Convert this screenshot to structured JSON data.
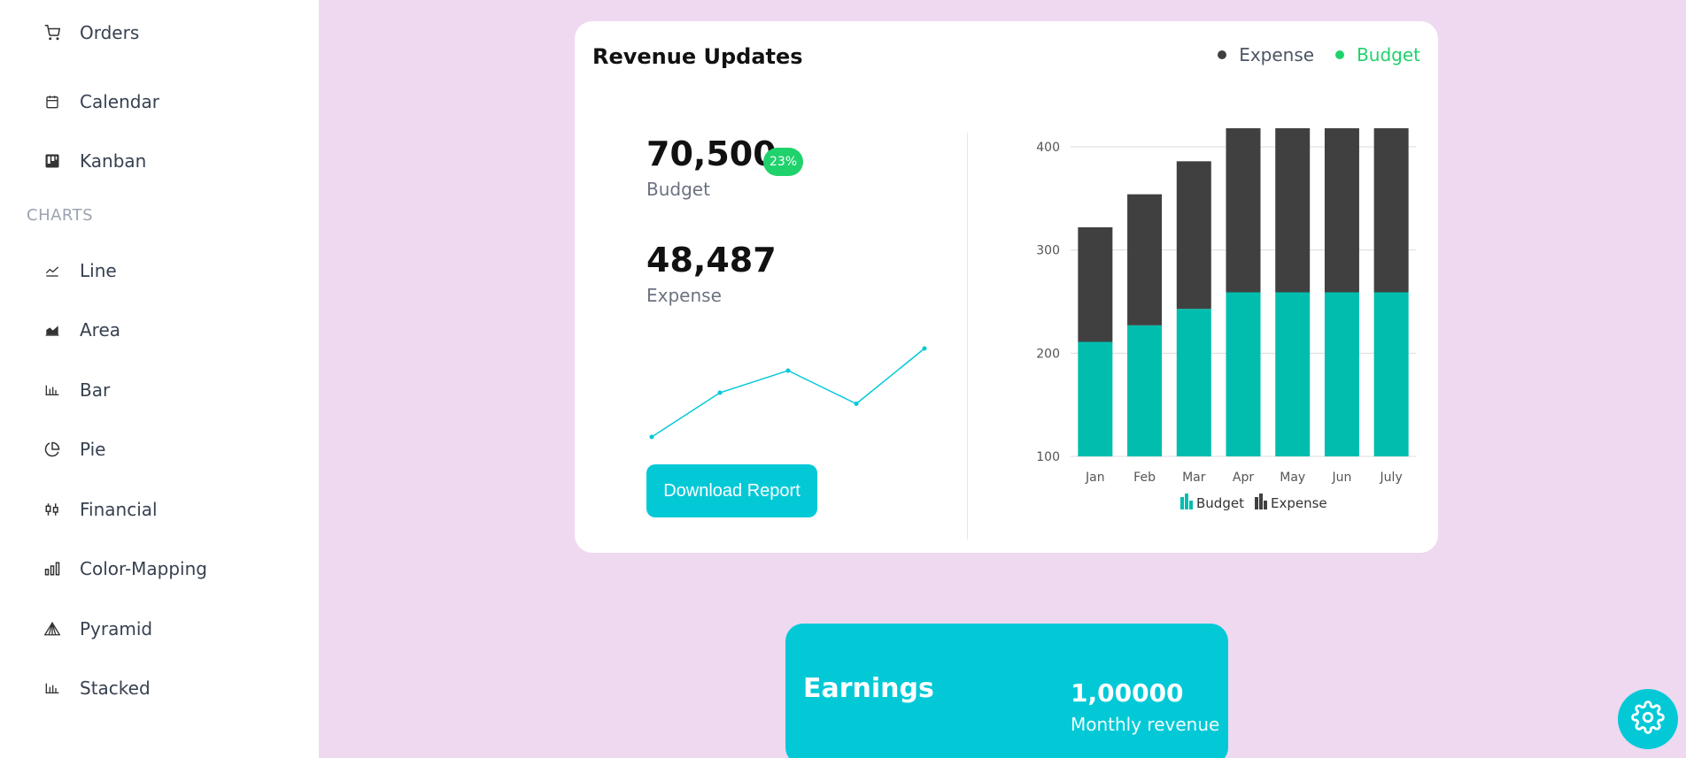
{
  "sidebar": {
    "items_top": [
      {
        "label": "Orders",
        "icon": "cart-icon"
      },
      {
        "label": "Calendar",
        "icon": "calendar-icon"
      },
      {
        "label": "Kanban",
        "icon": "kanban-icon"
      }
    ],
    "section_title": "CHARTS",
    "chart_items": [
      {
        "label": "Line",
        "icon": "line-chart-icon"
      },
      {
        "label": "Area",
        "icon": "area-chart-icon"
      },
      {
        "label": "Bar",
        "icon": "bar-chart-icon"
      },
      {
        "label": "Pie",
        "icon": "pie-chart-icon"
      },
      {
        "label": "Financial",
        "icon": "candlestick-icon"
      },
      {
        "label": "Color-Mapping",
        "icon": "color-mapping-icon"
      },
      {
        "label": "Pyramid",
        "icon": "pyramid-icon"
      },
      {
        "label": "Stacked",
        "icon": "stacked-chart-icon"
      }
    ]
  },
  "revenue": {
    "title": "Revenue Updates",
    "legend": {
      "expense": "Expense",
      "budget": "Budget"
    },
    "budget_value": "70,500",
    "budget_label": "Budget",
    "badge": "23%",
    "expense_value": "48,487",
    "expense_label": "Expense",
    "download_label": "Download Report"
  },
  "earnings": {
    "title": "Earnings",
    "value": "1,00000",
    "subtitle": "Monthly revenue"
  },
  "colors": {
    "accent": "#03c9d7",
    "budget_green": "#1fd26c",
    "expense_dark": "#404041",
    "budget_teal": "#00bdae",
    "background": "#eed9f1"
  },
  "chart_data": [
    {
      "type": "line",
      "x": [
        1,
        2,
        3,
        4,
        5
      ],
      "values": [
        1.0,
        2.2,
        2.8,
        1.9,
        3.4
      ],
      "color": "#03c9d7"
    },
    {
      "type": "bar",
      "stacked": true,
      "categories": [
        "Jan",
        "Feb",
        "Mar",
        "Apr",
        "May",
        "Jun",
        "July"
      ],
      "series": [
        {
          "name": "Budget",
          "values": [
            111,
            127,
            143,
            159,
            159,
            159,
            159
          ],
          "color": "#00bdae"
        },
        {
          "name": "Expense",
          "values": [
            111,
            127,
            143,
            159,
            159,
            159,
            159
          ],
          "color": "#404041"
        }
      ],
      "yticks": [
        100,
        200,
        300,
        400
      ],
      "ylim": [
        100,
        400
      ],
      "legend": "bottom",
      "grid": true
    }
  ]
}
